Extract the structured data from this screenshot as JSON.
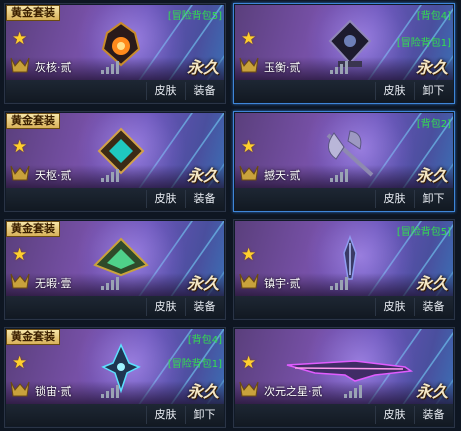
{
  "cards": [
    {
      "tag": "黄金套装",
      "slots": [
        "[冒险背包5]"
      ],
      "name": "灰核·贰",
      "permanence": "永久",
      "skin_label": "皮肤",
      "action_label": "装备",
      "equipped": false,
      "art": "amber-core",
      "icons": [
        "star-icon",
        "rank-emblem-icon",
        "signal-bars-icon"
      ]
    },
    {
      "tag": "",
      "slots": [
        "[背包4]",
        "[冒险背包1]"
      ],
      "name": "玉衡·贰",
      "permanence": "永久",
      "skin_label": "皮肤",
      "action_label": "卸下",
      "equipped": true,
      "art": "dark-orb",
      "icons": [
        "star-icon",
        "rank-emblem-icon",
        "signal-bars-icon"
      ]
    },
    {
      "tag": "黄金套装",
      "slots": [],
      "name": "天枢·贰",
      "permanence": "永久",
      "skin_label": "皮肤",
      "action_label": "装备",
      "equipped": false,
      "art": "teal-diamond",
      "icons": [
        "star-icon",
        "rank-emblem-icon",
        "signal-bars-icon"
      ]
    },
    {
      "tag": "",
      "slots": [
        "[背包2]"
      ],
      "name": "撼天·贰",
      "permanence": "永久",
      "skin_label": "皮肤",
      "action_label": "卸下",
      "equipped": true,
      "art": "battle-axe",
      "icons": [
        "star-icon",
        "rank-emblem-icon",
        "signal-bars-icon"
      ]
    },
    {
      "tag": "黄金套装",
      "slots": [],
      "name": "无暇·壹",
      "permanence": "永久",
      "skin_label": "皮肤",
      "action_label": "装备",
      "equipped": false,
      "art": "jade-prism",
      "icons": [
        "star-icon",
        "rank-emblem-icon",
        "signal-bars-icon"
      ]
    },
    {
      "tag": "",
      "slots": [
        "[冒险背包5]"
      ],
      "name": "镇宇·贰",
      "permanence": "永久",
      "skin_label": "皮肤",
      "action_label": "装备",
      "equipped": false,
      "art": "blade",
      "icons": [
        "star-icon",
        "rank-emblem-icon",
        "signal-bars-icon"
      ]
    },
    {
      "tag": "黄金套装",
      "slots": [
        "[背包4]",
        "[冒险背包1]"
      ],
      "name": "锁宙·贰",
      "permanence": "永久",
      "skin_label": "皮肤",
      "action_label": "卸下",
      "equipped": false,
      "art": "crystal-spire",
      "icons": [
        "star-icon",
        "rank-emblem-icon",
        "signal-bars-icon"
      ]
    },
    {
      "tag": "",
      "slots": [],
      "name": "次元之星·贰",
      "permanence": "永久",
      "skin_label": "皮肤",
      "action_label": "装备",
      "equipped": false,
      "art": "rifle",
      "icons": [
        "star-icon",
        "rank-emblem-icon",
        "signal-bars-icon"
      ]
    }
  ],
  "colors": {
    "slot_label": "#33e04d",
    "equipped_border": "#3f86d8",
    "tag_gold": "#d9b25a"
  }
}
